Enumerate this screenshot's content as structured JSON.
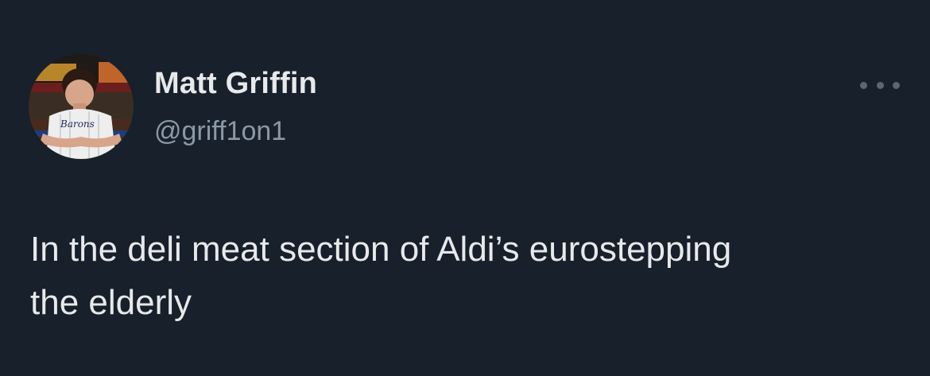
{
  "author": {
    "display_name": "Matt Griffin",
    "handle": "@griff1on1",
    "avatar_jersey_text": "Barons"
  },
  "tweet": {
    "text": "In the deli meat section of Aldi’s eurostepping\nthe elderly"
  },
  "icons": {
    "more": "more-horizontal-icon"
  },
  "colors": {
    "background": "#17202b",
    "primary_text": "#e7e9ea",
    "secondary_text": "#8b98a5"
  }
}
